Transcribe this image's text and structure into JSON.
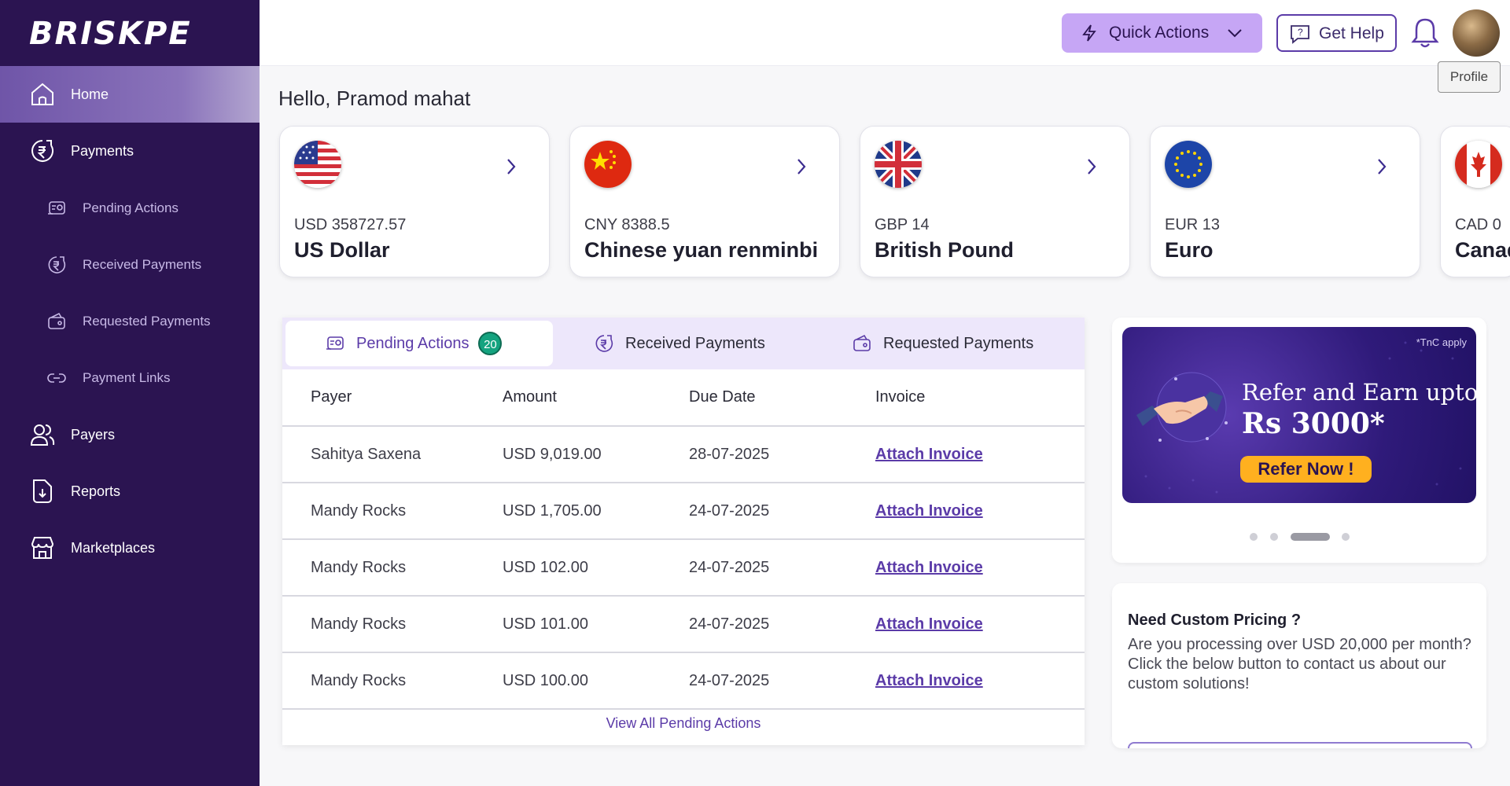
{
  "app": {
    "logo": "BRISKPE"
  },
  "sidebar": {
    "items": [
      {
        "label": "Home",
        "icon": "home-icon",
        "active": true
      },
      {
        "label": "Payments",
        "icon": "rupee-payment-icon"
      },
      {
        "label": "Pending Actions",
        "icon": "pending-actions-icon",
        "sub": true
      },
      {
        "label": "Received Payments",
        "icon": "received-payments-icon",
        "sub": true
      },
      {
        "label": "Requested Payments",
        "icon": "requested-payments-icon",
        "sub": true
      },
      {
        "label": "Payment Links",
        "icon": "link-icon",
        "sub": true
      },
      {
        "label": "Payers",
        "icon": "users-icon"
      },
      {
        "label": "Reports",
        "icon": "reports-icon"
      },
      {
        "label": "Marketplaces",
        "icon": "marketplace-icon"
      }
    ]
  },
  "header": {
    "quick_actions": "Quick Actions",
    "get_help": "Get Help",
    "profile_tooltip": "Profile"
  },
  "greeting": "Hello, Pramod mahat",
  "currencies": [
    {
      "amount": "USD 358727.57",
      "name": "US Dollar",
      "flag": "us-flag-icon"
    },
    {
      "amount": "CNY 8388.5",
      "name": "Chinese yuan renminbi",
      "flag": "china-flag-icon"
    },
    {
      "amount": "GBP 14",
      "name": "British Pound",
      "flag": "uk-flag-icon"
    },
    {
      "amount": "EUR 13",
      "name": "Euro",
      "flag": "eu-flag-icon"
    },
    {
      "amount": "CAD 0",
      "name": "Canadian Dollar",
      "flag": "canada-flag-icon"
    }
  ],
  "tabs": {
    "pending": "Pending Actions",
    "pending_count": "20",
    "received": "Received Payments",
    "requested": "Requested Payments"
  },
  "table": {
    "headers": [
      "Payer",
      "Amount",
      "Due Date",
      "Invoice"
    ],
    "rows": [
      {
        "payer": "Sahitya Saxena",
        "amount": "USD 9,019.00",
        "due": "28-07-2025",
        "invoice": "Attach Invoice"
      },
      {
        "payer": "Mandy Rocks",
        "amount": "USD 1,705.00",
        "due": "24-07-2025",
        "invoice": "Attach Invoice"
      },
      {
        "payer": "Mandy Rocks",
        "amount": "USD 102.00",
        "due": "24-07-2025",
        "invoice": "Attach Invoice"
      },
      {
        "payer": "Mandy Rocks",
        "amount": "USD 101.00",
        "due": "24-07-2025",
        "invoice": "Attach Invoice"
      },
      {
        "payer": "Mandy Rocks",
        "amount": "USD 100.00",
        "due": "24-07-2025",
        "invoice": "Attach Invoice"
      }
    ],
    "view_all": "View All Pending Actions"
  },
  "promo": {
    "tnc": "*TnC apply",
    "line1": "Refer and Earn upto",
    "line2": "Rs 3000*",
    "button": "Refer Now !",
    "slide_count": 4,
    "active_slide": 3
  },
  "pricing": {
    "title": "Need Custom Pricing ?",
    "description": "Are you processing over USD 20,000 per month? Click the below button to contact us about our custom solutions!"
  },
  "colors": {
    "sidebar_bg": "#2b1451",
    "accent": "#5b3ba8",
    "quick_actions_bg": "#c6a6f5",
    "badge": "#14a37f",
    "refer_button": "#ffb01f"
  }
}
